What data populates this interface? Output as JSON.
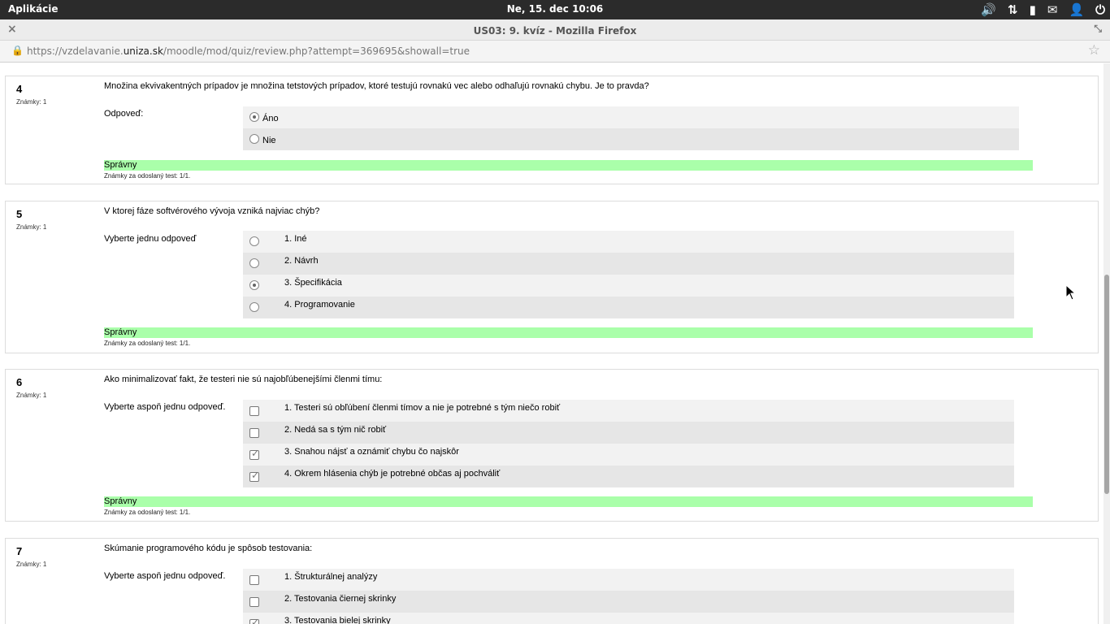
{
  "topbar": {
    "apps": "Aplikácie",
    "clock": "Ne, 15. dec 10:06",
    "icons": [
      "volume-icon",
      "network-icon",
      "battery-icon",
      "mail-icon",
      "user-icon",
      "power-icon"
    ]
  },
  "window": {
    "title": "US03: 9. kvíz - Mozilla Firefox",
    "close": "×",
    "restore": "⤡"
  },
  "urlbar": {
    "prefix": "https://vzdelavanie.",
    "domain": "uniza.sk",
    "path": "/moodle/mod/quiz/review.php?attempt=369695&showall=true"
  },
  "questions": [
    {
      "number": "4",
      "marks": "Známky: 1",
      "text": "Množina ekvivakentných prípadov je množina tetstových prípadov, ktoré testujú rovnakú vec alebo odhaľujú rovnakú chybu. Je to pravda?",
      "prompt": "Odpoveď:",
      "options": [
        {
          "label": "Áno",
          "selected": true
        },
        {
          "label": "Nie",
          "selected": false
        }
      ],
      "result": "Správny",
      "grade": "Známky za odoslaný test: 1/1."
    },
    {
      "number": "5",
      "marks": "Známky: 1",
      "text": "V ktorej fáze softvérového vývoja vzniká najviac chýb?",
      "prompt": "Vyberte jednu odpoveď",
      "options": [
        {
          "label": "1. Iné",
          "selected": false
        },
        {
          "label": "2. Návrh",
          "selected": false
        },
        {
          "label": "3. Špecifikácia",
          "selected": true
        },
        {
          "label": "4. Programovanie",
          "selected": false
        }
      ],
      "result": "Správny",
      "grade": "Známky za odoslaný test: 1/1."
    },
    {
      "number": "6",
      "marks": "Známky: 1",
      "text": "Ako minimalizovať fakt, že testeri nie sú najobľúbenejšími členmi tímu:",
      "prompt": "Vyberte aspoň jednu odpoveď.",
      "options": [
        {
          "label": "1. Testeri sú obľúbení členmi tímov a nie je potrebné s tým niečo robiť",
          "checked": false
        },
        {
          "label": "2. Nedá sa s tým nič robiť",
          "checked": false
        },
        {
          "label": "3. Snahou nájsť a oznámiť chybu čo najskôr",
          "checked": true
        },
        {
          "label": "4. Okrem hlásenia chýb je potrebné občas aj pochváliť",
          "checked": true
        }
      ],
      "result": "Správny",
      "grade": "Známky za odoslaný test: 1/1."
    },
    {
      "number": "7",
      "marks": "Známky: 1",
      "text": "Skúmanie programového kódu je spôsob testovania:",
      "prompt": "Vyberte aspoň jednu odpoveď.",
      "options": [
        {
          "label": "1. Štrukturálnej analýzy",
          "checked": false
        },
        {
          "label": "2. Testovania čiernej skrinky",
          "checked": false
        },
        {
          "label": "3. Testovania bielej skrinky",
          "checked": true
        }
      ]
    }
  ]
}
